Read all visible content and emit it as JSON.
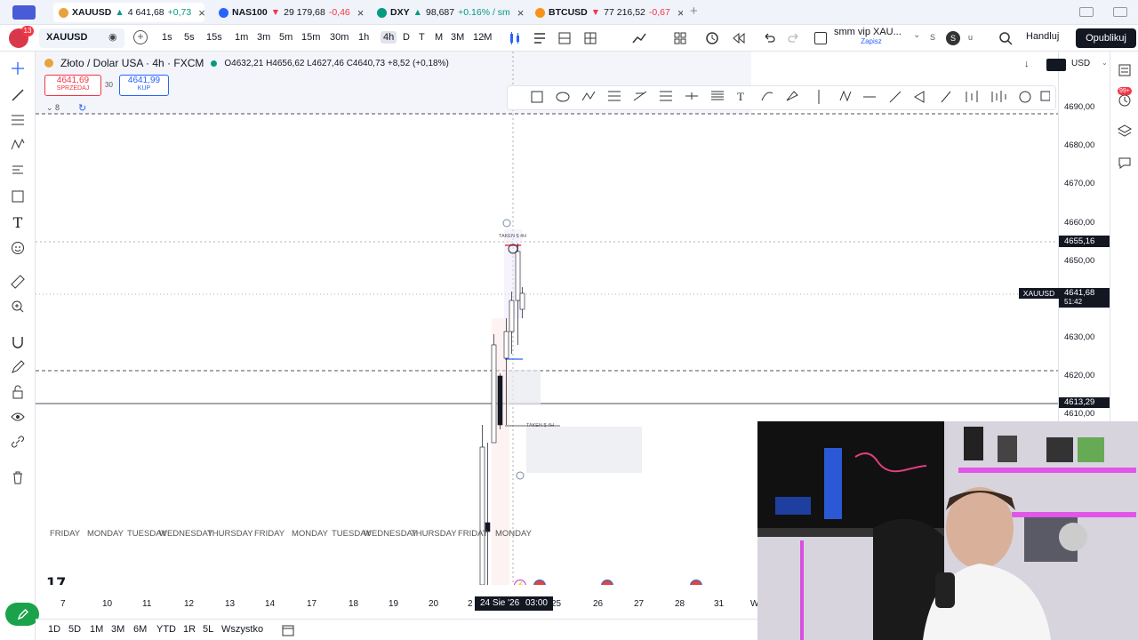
{
  "tabs": [
    {
      "symbol": "XAUUSD",
      "arrow": "▲",
      "price": "4 641,68",
      "change": "+0,73",
      "dir": "up",
      "color": "#e8a33d"
    },
    {
      "symbol": "NAS100",
      "arrow": "▼",
      "price": "29 179,68",
      "change": "-0,46",
      "dir": "dn",
      "color": "#2962ff"
    },
    {
      "symbol": "DXY",
      "arrow": "▲",
      "price": "98,687",
      "change": "+0.16% / sm",
      "dir": "up",
      "color": "#089981"
    },
    {
      "symbol": "BTCUSD",
      "arrow": "▼",
      "price": "77 216,52",
      "change": "-0,67",
      "dir": "dn",
      "color": "#f7931a"
    }
  ],
  "toolbar": {
    "notif": "13",
    "symbol": "XAUUSD",
    "intervals": [
      "1s",
      "5s",
      "15s",
      "1m",
      "3m",
      "5m",
      "15m",
      "30m",
      "1h",
      "4h",
      "D",
      "T",
      "M",
      "3M",
      "12M"
    ],
    "active_interval": "4h",
    "layout_name": "smm vip XAU...",
    "layout_sub": "Zapisz",
    "avatar_letter": "S",
    "user_letter": "u",
    "trade": "Handluj",
    "publish": "Opublikuj"
  },
  "legend": {
    "title": "Złoto / Dolar USA · 4h · FXCM",
    "ohlc": "O4632,21 H4656,62 L4627,46 C4640,73 +8,52 (+0,18%)",
    "sell_price": "4641,69",
    "sell_label": "SPRZEDAJ",
    "spread": "30",
    "buy_price": "4641,99",
    "buy_label": "KUP",
    "indicators_count": "8"
  },
  "axis": {
    "currency": "USD",
    "prices": [
      "4690,00",
      "4680,00",
      "4670,00",
      "4660,00",
      "4650,00",
      "4640,00",
      "4630,00",
      "4620,00",
      "4610,00"
    ],
    "crosshair_price": "4655,16",
    "current_symbol": "XAUUSD",
    "current_price": "4641,68",
    "countdown": "51:42",
    "line_price": "4613,29"
  },
  "xaxis": {
    "labels": [
      "7",
      "10",
      "11",
      "12",
      "13",
      "14",
      "17",
      "18",
      "19",
      "20",
      "2",
      "25",
      "26",
      "27",
      "28",
      "31",
      "W"
    ],
    "crosshair_date": "24 Sie '26",
    "crosshair_time": "03:00",
    "days": [
      "FRIDAY",
      "MONDAY",
      "TUESDAY",
      "WEDNESDAY",
      "THURSDAY",
      "FRIDAY",
      "MONDAY",
      "TUESDAY",
      "WEDNESDAY",
      "THURSDAY",
      "FRIDAY",
      "MONDAY"
    ]
  },
  "annotations": {
    "taken1": "TAKEN $ 4H",
    "taken2": "TAKEN $ 4H"
  },
  "bottom": {
    "ranges": [
      "1D",
      "5D",
      "1M",
      "3M",
      "6M",
      "YTD",
      "1R",
      "5L",
      "Wszystko"
    ]
  },
  "right_badge": "99+",
  "icons": {
    "colors": {
      "up": "#089981",
      "down": "#f23645",
      "accent": "#2962ff"
    }
  }
}
